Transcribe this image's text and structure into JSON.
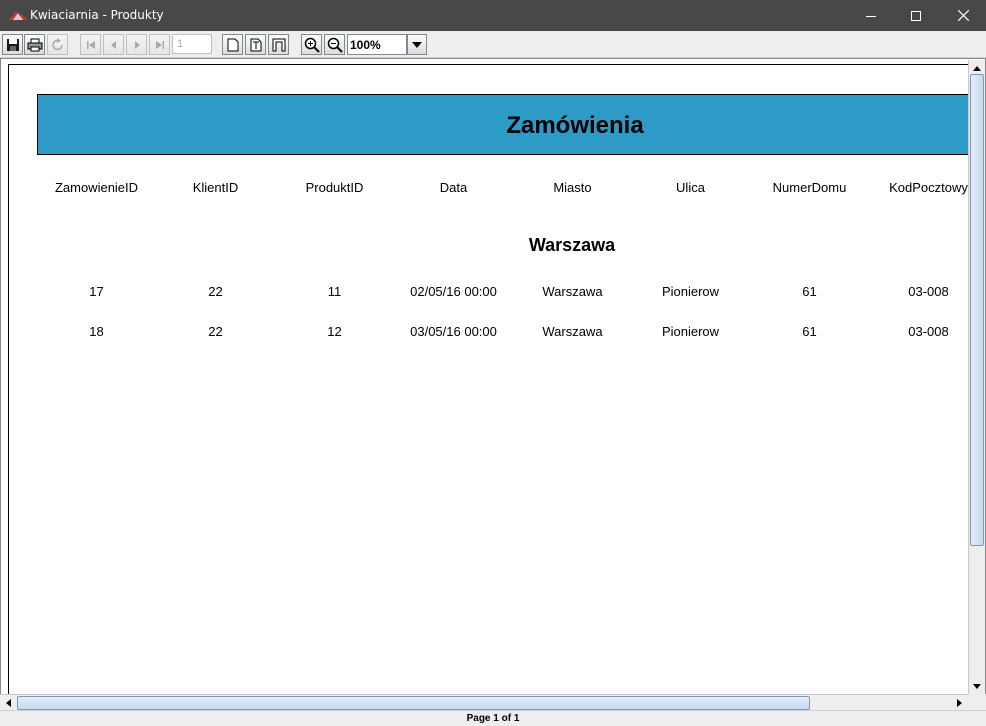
{
  "window": {
    "title": "Kwiaciarnia - Produkty"
  },
  "toolbar": {
    "page_number": "1",
    "zoom": "100%"
  },
  "report": {
    "title": "Zamówienia",
    "columns": [
      "ZamowienieID",
      "KlientID",
      "ProduktID",
      "Data",
      "Miasto",
      "Ulica",
      "NumerDomu",
      "KodPocztowy"
    ],
    "group_title": "Warszawa",
    "rows": [
      [
        "17",
        "22",
        "11",
        "02/05/16 00:00",
        "Warszawa",
        "Pionierow",
        "61",
        "03-008"
      ],
      [
        "18",
        "22",
        "12",
        "03/05/16 00:00",
        "Warszawa",
        "Pionierow",
        "61",
        "03-008"
      ]
    ]
  },
  "status": {
    "page_label": "Page 1 of 1"
  },
  "colors": {
    "header_fill": "#2e9bc6",
    "titlebar": "#484848"
  }
}
